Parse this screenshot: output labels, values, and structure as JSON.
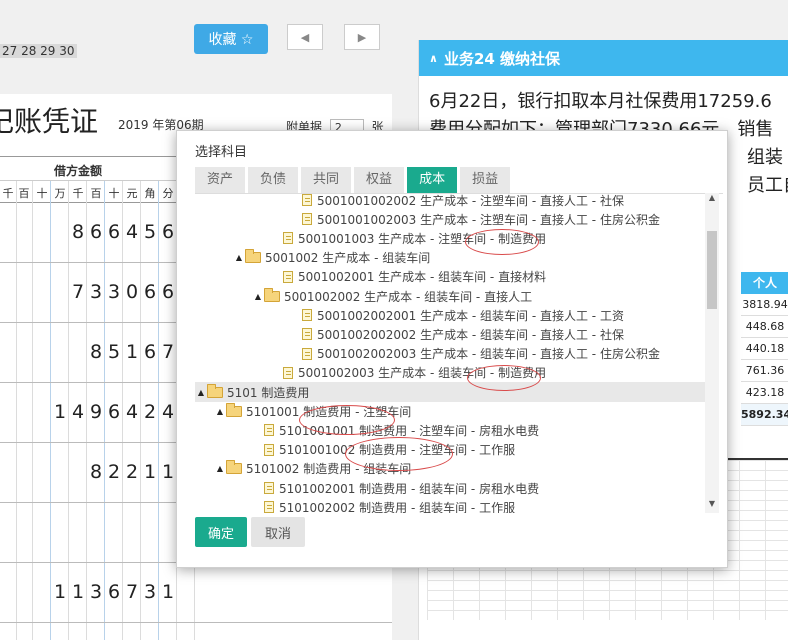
{
  "top": {
    "dates": "27 28 29 30",
    "favorite_label": "收藏 ☆",
    "prev_icon": "◀",
    "next_icon": "▶"
  },
  "voucher": {
    "title": "记账凭证",
    "period": "2019 年第06期",
    "attach_label": "附单据",
    "attach_count": "2",
    "attach_unit": "张",
    "debit_header": "借方金额",
    "digit_headers": [
      "千",
      "百",
      "十",
      "万",
      "千",
      "百",
      "十",
      "元",
      "角",
      "分"
    ],
    "amounts": [
      "866456",
      "733066",
      "85167",
      "1496424",
      "82211",
      "",
      "1136731"
    ]
  },
  "panel": {
    "header": "业务24 缴纳社保",
    "text_line1": "6月22日，银行扣取本月社保费用17259.6",
    "text_line2": "费用分配如下：管理部门7330.66元，销售",
    "text_line3": "组装",
    "text_line4": "员工自",
    "col_header": "个人",
    "col_values": [
      "3818.94",
      "448.68",
      "440.18",
      "761.36",
      "423.18",
      "5892.34"
    ]
  },
  "dialog": {
    "title": "选择科目",
    "tabs": [
      "资产",
      "负债",
      "共同",
      "权益",
      "成本",
      "损益"
    ],
    "active_tab": "成本",
    "nodes": [
      {
        "type": "file",
        "text": "5001001002002 生产成本 - 注塑车间 - 直接人工 - 社保"
      },
      {
        "type": "file",
        "text": "5001001002003 生产成本 - 注塑车间 - 直接人工 - 住房公积金"
      },
      {
        "type": "file",
        "text": "5001001003 生产成本 - 注塑车间 - 制造费用"
      },
      {
        "type": "folder",
        "text": "5001002 生产成本 - 组装车间"
      },
      {
        "type": "file",
        "text": "5001002001 生产成本 - 组装车间 - 直接材料"
      },
      {
        "type": "folder",
        "text": "5001002002 生产成本 - 组装车间 - 直接人工"
      },
      {
        "type": "file",
        "text": "5001002002001 生产成本 - 组装车间 - 直接人工 - 工资"
      },
      {
        "type": "file",
        "text": "5001002002002 生产成本 - 组装车间 - 直接人工 - 社保"
      },
      {
        "type": "file",
        "text": "5001002002003 生产成本 - 组装车间 - 直接人工 - 住房公积金"
      },
      {
        "type": "file",
        "text": "5001002003 生产成本 - 组装车间 - 制造费用"
      },
      {
        "type": "folder",
        "text": "5101 制造费用"
      },
      {
        "type": "folder",
        "text": "5101001 制造费用 - 注塑车间"
      },
      {
        "type": "file",
        "text": "5101001001 制造费用 - 注塑车间 - 房租水电费"
      },
      {
        "type": "file",
        "text": "5101001002 制造费用 - 注塑车间 - 工作服"
      },
      {
        "type": "folder",
        "text": "5101002 制造费用 - 组装车间"
      },
      {
        "type": "file",
        "text": "5101002001 制造费用 - 组装车间 - 房租水电费"
      },
      {
        "type": "file",
        "text": "5101002002 制造费用 - 组装车间 - 工作服"
      }
    ],
    "ok_label": "确定",
    "cancel_label": "取消"
  }
}
